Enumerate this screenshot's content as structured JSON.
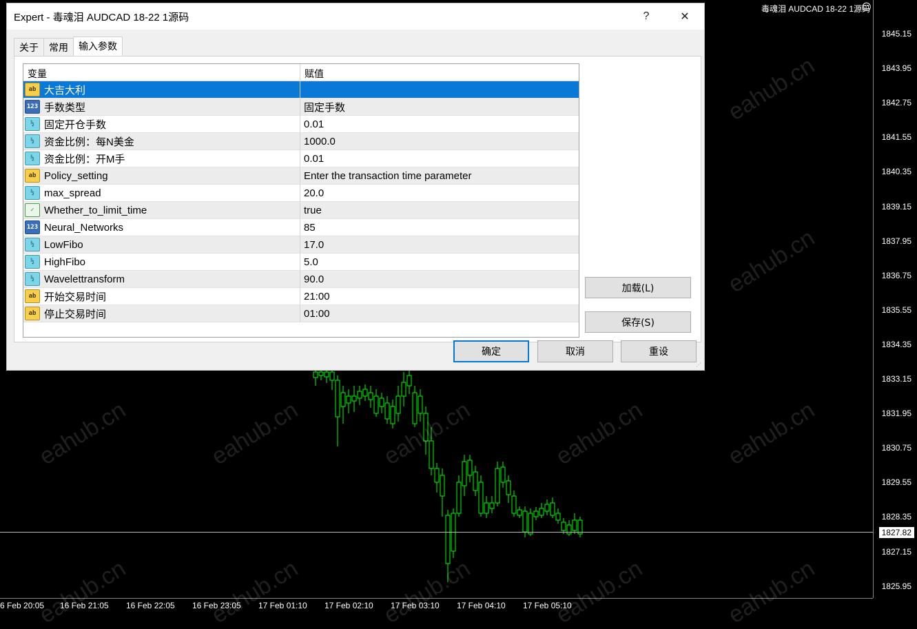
{
  "dialog": {
    "title": "Expert - 毒魂泪 AUDCAD 18-22  1源码",
    "help_glyph": "?",
    "close_glyph": "✕",
    "tabs": [
      {
        "label": "关于"
      },
      {
        "label": "常用"
      },
      {
        "label": "输入参数",
        "active": true
      }
    ],
    "grid": {
      "header_name": "变量",
      "header_value": "赋值",
      "rows": [
        {
          "type": "string",
          "icon": "ab",
          "name": "大吉大利",
          "value": "",
          "selected": true
        },
        {
          "type": "int",
          "icon": "123",
          "name": "手数类型",
          "value": "固定手数"
        },
        {
          "type": "double",
          "icon": "½",
          "name": "固定开仓手数",
          "value": "0.01"
        },
        {
          "type": "double",
          "icon": "½",
          "name": "资金比例：每N美金",
          "value": "1000.0"
        },
        {
          "type": "double",
          "icon": "½",
          "name": "资金比例：开M手",
          "value": "0.01"
        },
        {
          "type": "string",
          "icon": "ab",
          "name": "Policy_setting",
          "value": "Enter the transaction time parameter"
        },
        {
          "type": "double",
          "icon": "½",
          "name": "max_spread",
          "value": "20.0"
        },
        {
          "type": "bool",
          "icon": "✓",
          "name": "Whether_to_limit_time",
          "value": "true"
        },
        {
          "type": "int",
          "icon": "123",
          "name": "Neural_Networks",
          "value": "85"
        },
        {
          "type": "double",
          "icon": "½",
          "name": "LowFibo",
          "value": "17.0"
        },
        {
          "type": "double",
          "icon": "½",
          "name": "HighFibo",
          "value": "5.0"
        },
        {
          "type": "double",
          "icon": "½",
          "name": "Wavelettransform",
          "value": "90.0"
        },
        {
          "type": "string",
          "icon": "ab",
          "name": "开始交易时间",
          "value": "21:00"
        },
        {
          "type": "string",
          "icon": "ab",
          "name": "停止交易时间",
          "value": "01:00"
        }
      ]
    },
    "load_label": "加载(L)",
    "save_label": "保存(S)",
    "ok_label": "确定",
    "cancel_label": "取消",
    "reset_label": "重设"
  },
  "chart": {
    "header": "毒魂泪 AUDCAD 18-22  1源码",
    "header_icon": "smiley-icon",
    "current_price": "1827.82",
    "price_labels": [
      "1845.15",
      "1843.95",
      "1842.75",
      "1841.55",
      "1840.35",
      "1839.15",
      "1837.95",
      "1836.75",
      "1835.55",
      "1834.35",
      "1833.15",
      "1831.95",
      "1830.75",
      "1829.55",
      "1828.35",
      "1827.15",
      "1825.95"
    ],
    "time_labels": [
      "6 Feb 20:05",
      "16 Feb 21:05",
      "16 Feb 22:05",
      "16 Feb 23:05",
      "17 Feb 01:10",
      "17 Feb 02:10",
      "17 Feb 03:10",
      "17 Feb 04:10",
      "17 Feb 05:10"
    ],
    "watermark": "eahub.cn",
    "candle_color": "#00ff00",
    "background": "#000000"
  }
}
